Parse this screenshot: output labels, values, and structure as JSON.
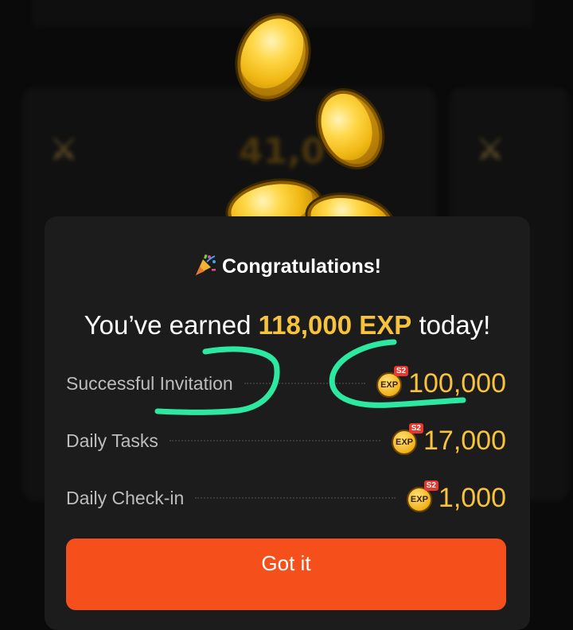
{
  "background": {
    "coin_value_partial": "41,0"
  },
  "modal": {
    "title": "Congratulations!",
    "title_icon": "party-popper-icon",
    "earned_prefix": "You’ve earned ",
    "earned_amount": "118,000 EXP",
    "earned_suffix": " today!",
    "rows": [
      {
        "label": "Successful Invitation",
        "badge_text": "EXP",
        "season_tag": "S2",
        "value": "100,000"
      },
      {
        "label": "Daily Tasks",
        "badge_text": "EXP",
        "season_tag": "S2",
        "value": "17,000"
      },
      {
        "label": "Daily Check-in",
        "badge_text": "EXP",
        "season_tag": "S2",
        "value": "1,000"
      }
    ],
    "button_label": "Got it"
  },
  "colors": {
    "accent_gold": "#f7c23c",
    "button_orange": "#f5501c",
    "annotation_green": "#2de8a0"
  }
}
